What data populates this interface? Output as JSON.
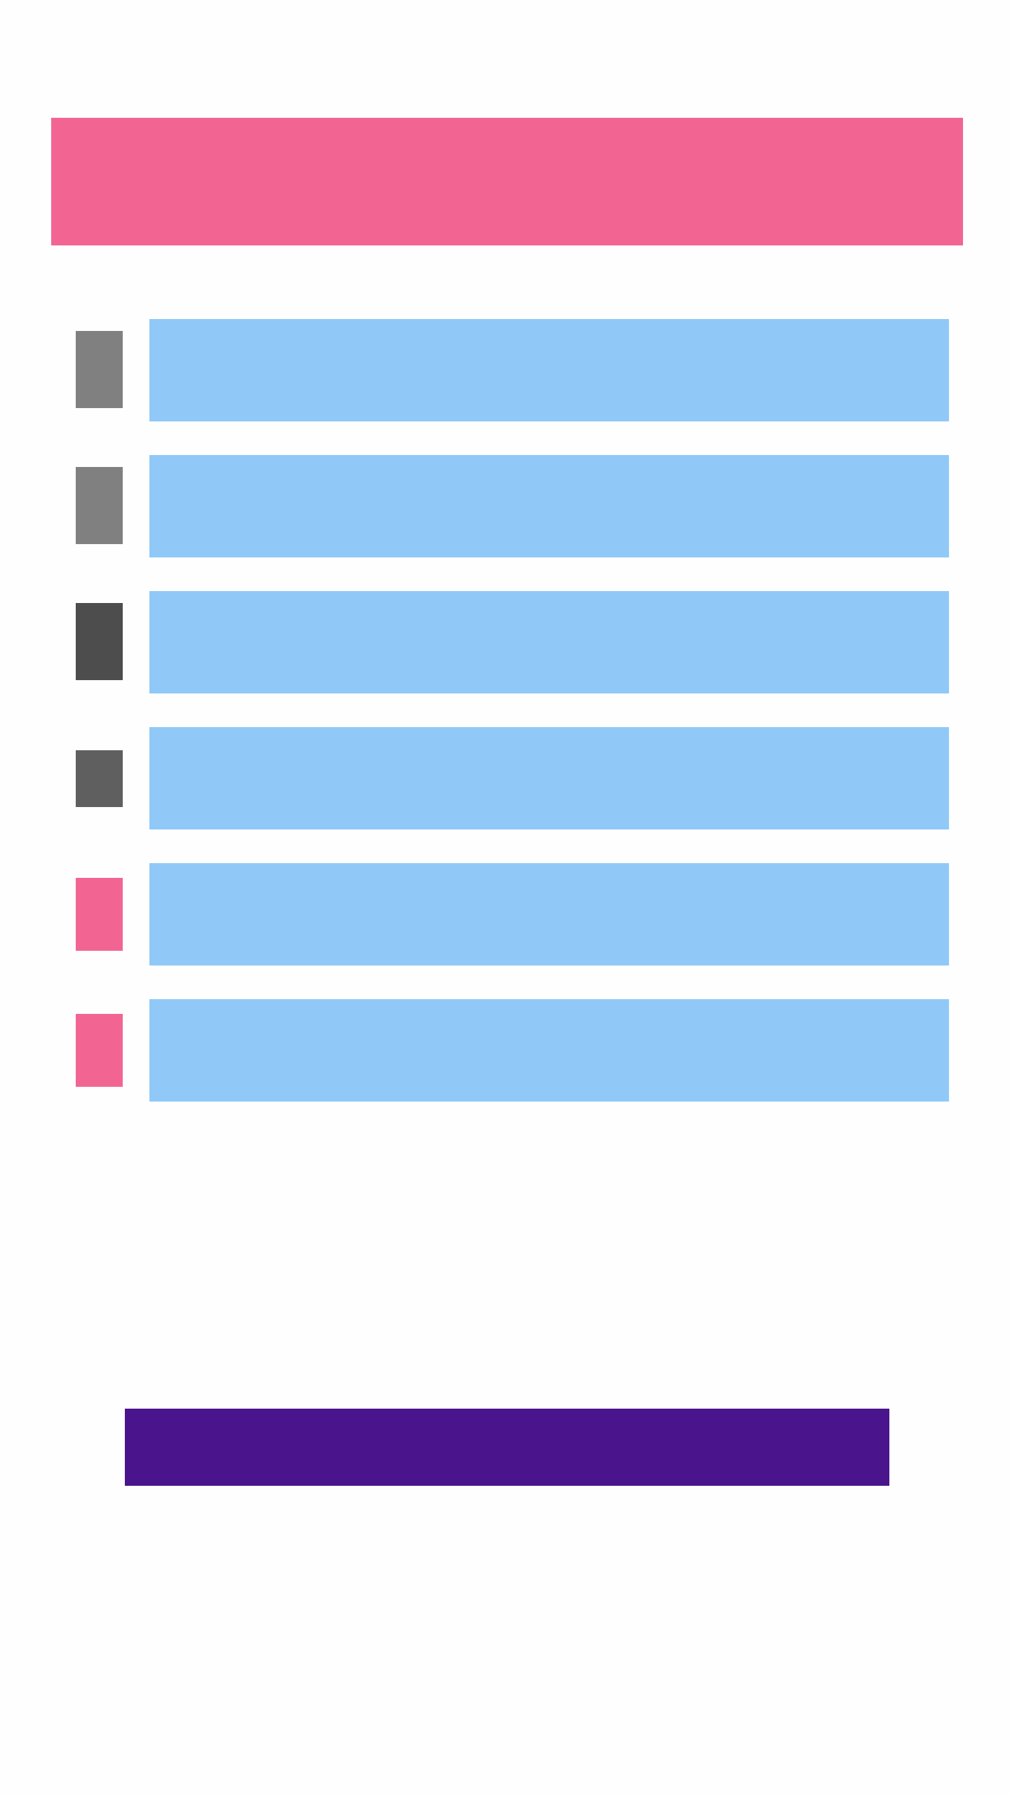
{
  "colors": {
    "background": "#fefefe",
    "header": "#f26593",
    "card": "#90c9f8",
    "button": "#4a148c",
    "icon_gray_light": "#808080",
    "icon_gray_dark": "#4d4d4d",
    "icon_gray_mid": "#5f5f5f",
    "icon_pink": "#f26593"
  },
  "header": {
    "title": ""
  },
  "list": {
    "items": [
      {
        "icon": "placeholder-icon",
        "label": ""
      },
      {
        "icon": "placeholder-icon",
        "label": ""
      },
      {
        "icon": "placeholder-icon",
        "label": ""
      },
      {
        "icon": "placeholder-icon",
        "label": ""
      },
      {
        "icon": "placeholder-icon",
        "label": ""
      },
      {
        "icon": "placeholder-icon",
        "label": ""
      }
    ]
  },
  "action": {
    "label": ""
  }
}
